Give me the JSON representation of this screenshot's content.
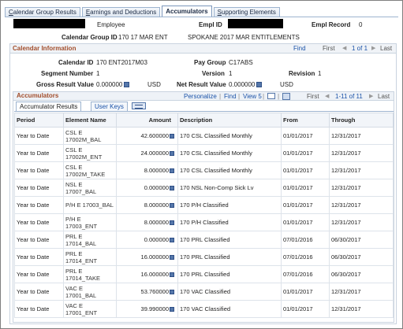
{
  "tabs": [
    {
      "label": "Calendar Group Results",
      "underline": "C",
      "rest": "alendar Group Results",
      "active": false
    },
    {
      "label": "Earnings and Deductions",
      "underline": "E",
      "rest": "arnings and Deductions",
      "active": false
    },
    {
      "label": "Accumulators",
      "underline": "",
      "rest": "Accumulators",
      "active": true
    },
    {
      "label": "Supporting Elements",
      "underline": "S",
      "rest": "upporting Elements",
      "active": false
    }
  ],
  "header": {
    "employee_label": "Employee",
    "empl_id_label": "Empl ID",
    "empl_record_label": "Empl Record",
    "empl_record_value": "0",
    "calendar_group_id_label": "Calendar Group ID",
    "calendar_group_id_value": "170 17 MAR ENT",
    "calendar_group_desc": "SPOKANE 2017 MAR ENTITLEMENTS"
  },
  "calendar_info": {
    "title": "Calendar Information",
    "find": "Find",
    "first": "First",
    "page_status": "1 of 1",
    "last": "Last",
    "calendar_id_label": "Calendar ID",
    "calendar_id_value": "170 ENT2017M03",
    "pay_group_label": "Pay Group",
    "pay_group_value": "C17ABS",
    "segment_number_label": "Segment Number",
    "segment_number_value": "1",
    "version_label": "Version",
    "version_value": "1",
    "revision_label": "Revision",
    "revision_value": "1",
    "gross_result_label": "Gross Result Value",
    "gross_result_value": "0.000000",
    "gross_currency": "USD",
    "net_result_label": "Net Result Value",
    "net_result_value": "0.000000",
    "net_currency": "USD"
  },
  "accumulators": {
    "title": "Accumulators",
    "personalize": "Personalize",
    "find": "Find",
    "view": "View 5",
    "first": "First",
    "page_status": "1-11 of 11",
    "last": "Last",
    "subtabs": [
      "Accumulator Results",
      "User Keys"
    ],
    "columns": [
      "Period",
      "Element Name",
      "Amount",
      "Description",
      "From",
      "Through"
    ],
    "rows": [
      {
        "period": "Year to Date",
        "element": "CSL E\n17002M_BAL",
        "amount": "42.600000",
        "description": "170 CSL Classified Monthly",
        "from": "01/01/2017",
        "through": "12/31/2017"
      },
      {
        "period": "Year to Date",
        "element": "CSL E\n17002M_ENT",
        "amount": "24.000000",
        "description": "170 CSL Classified Monthly",
        "from": "01/01/2017",
        "through": "12/31/2017"
      },
      {
        "period": "Year to Date",
        "element": "CSL E\n17002M_TAKE",
        "amount": "8.000000",
        "description": "170 CSL Classified Monthly",
        "from": "01/01/2017",
        "through": "12/31/2017"
      },
      {
        "period": "Year to Date",
        "element": "NSL E\n17007_BAL",
        "amount": "0.000000",
        "description": "170 NSL Non-Comp Sick Lv",
        "from": "01/01/2017",
        "through": "12/31/2017"
      },
      {
        "period": "Year to Date",
        "element": "P/H E 17003_BAL",
        "amount": "8.000000",
        "description": "170 P/H Classified",
        "from": "01/01/2017",
        "through": "12/31/2017"
      },
      {
        "period": "Year to Date",
        "element": "P/H E\n17003_ENT",
        "amount": "8.000000",
        "description": "170 P/H Classified",
        "from": "01/01/2017",
        "through": "12/31/2017"
      },
      {
        "period": "Year to Date",
        "element": "PRL E\n17014_BAL",
        "amount": "0.000000",
        "description": "170 PRL Classified",
        "from": "07/01/2016",
        "through": "06/30/2017"
      },
      {
        "period": "Year to Date",
        "element": "PRL E\n17014_ENT",
        "amount": "16.000000",
        "description": "170 PRL Classified",
        "from": "07/01/2016",
        "through": "06/30/2017"
      },
      {
        "period": "Year to Date",
        "element": "PRL E\n17014_TAKE",
        "amount": "16.000000",
        "description": "170 PRL Classified",
        "from": "07/01/2016",
        "through": "06/30/2017"
      },
      {
        "period": "Year to Date",
        "element": "VAC E\n17001_BAL",
        "amount": "53.760000",
        "description": "170 VAC Classified",
        "from": "01/01/2017",
        "through": "12/31/2017"
      },
      {
        "period": "Year to Date",
        "element": "VAC E\n17001_ENT",
        "amount": "39.990000",
        "description": "170 VAC Classified",
        "from": "01/01/2017",
        "through": "12/31/2017"
      }
    ]
  }
}
